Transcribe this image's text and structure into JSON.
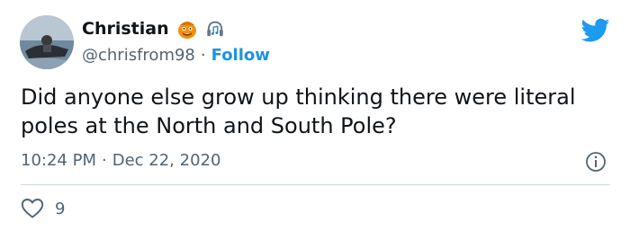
{
  "author": {
    "display_name": "Christian",
    "handle": "@chrisfrom98",
    "follow_label": "Follow",
    "separator": "·",
    "avatar_icon": "avatar-jetski-photo",
    "emoji_1": "orange-character-emoji",
    "emoji_2": "headphones-emoji"
  },
  "brand": {
    "icon": "twitter-bird-icon",
    "color": "#1d9bf0"
  },
  "tweet": {
    "text": "Did anyone else grow up thinking there were literal poles at the North and South Pole?",
    "time": "10:24 PM",
    "separator": "·",
    "date": "Dec 22, 2020"
  },
  "actions": {
    "like_count": "9",
    "like_icon": "heart-icon",
    "info_icon": "info-icon"
  },
  "colors": {
    "link": "#1b95e0",
    "muted": "#536471",
    "text": "#0f1419",
    "divider": "#cfd9de"
  }
}
